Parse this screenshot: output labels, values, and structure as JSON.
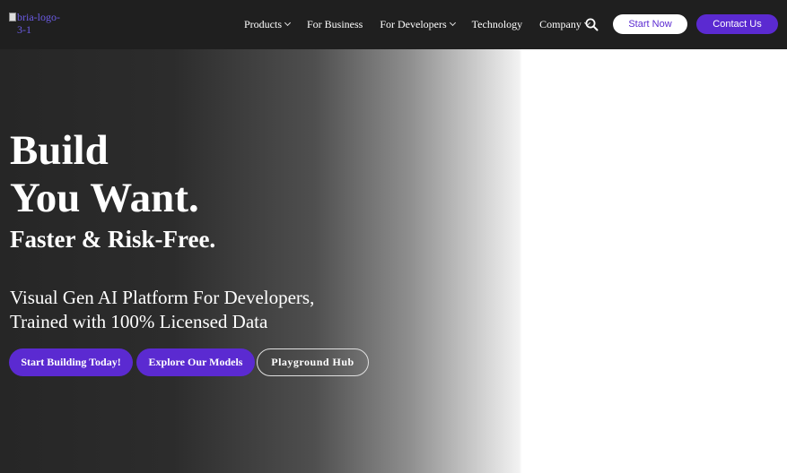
{
  "header": {
    "logo_alt": "bria-logo-3-1",
    "nav": [
      {
        "label": "Products",
        "dropdown": true
      },
      {
        "label": "For Business",
        "dropdown": false
      },
      {
        "label": "For Developers",
        "dropdown": true
      },
      {
        "label": "Technology",
        "dropdown": false
      },
      {
        "label": "Company",
        "dropdown": true
      }
    ],
    "search_icon": "search-icon",
    "start_now_label": "Start Now",
    "contact_label": "Contact Us"
  },
  "hero": {
    "title_line1": "Build",
    "title_line2": "You Want.",
    "subtitle": "Faster & Risk-Free.",
    "desc_line1": "Visual Gen AI Platform For Developers,",
    "desc_line2": "Trained with 100% Licensed Data",
    "buttons": {
      "build": "Start Building Today!",
      "explore": "Explore Our Models",
      "playground": "Playground Hub"
    }
  },
  "colors": {
    "brand_purple": "#5b2ad1",
    "nav_bg": "#1f1f1f"
  }
}
